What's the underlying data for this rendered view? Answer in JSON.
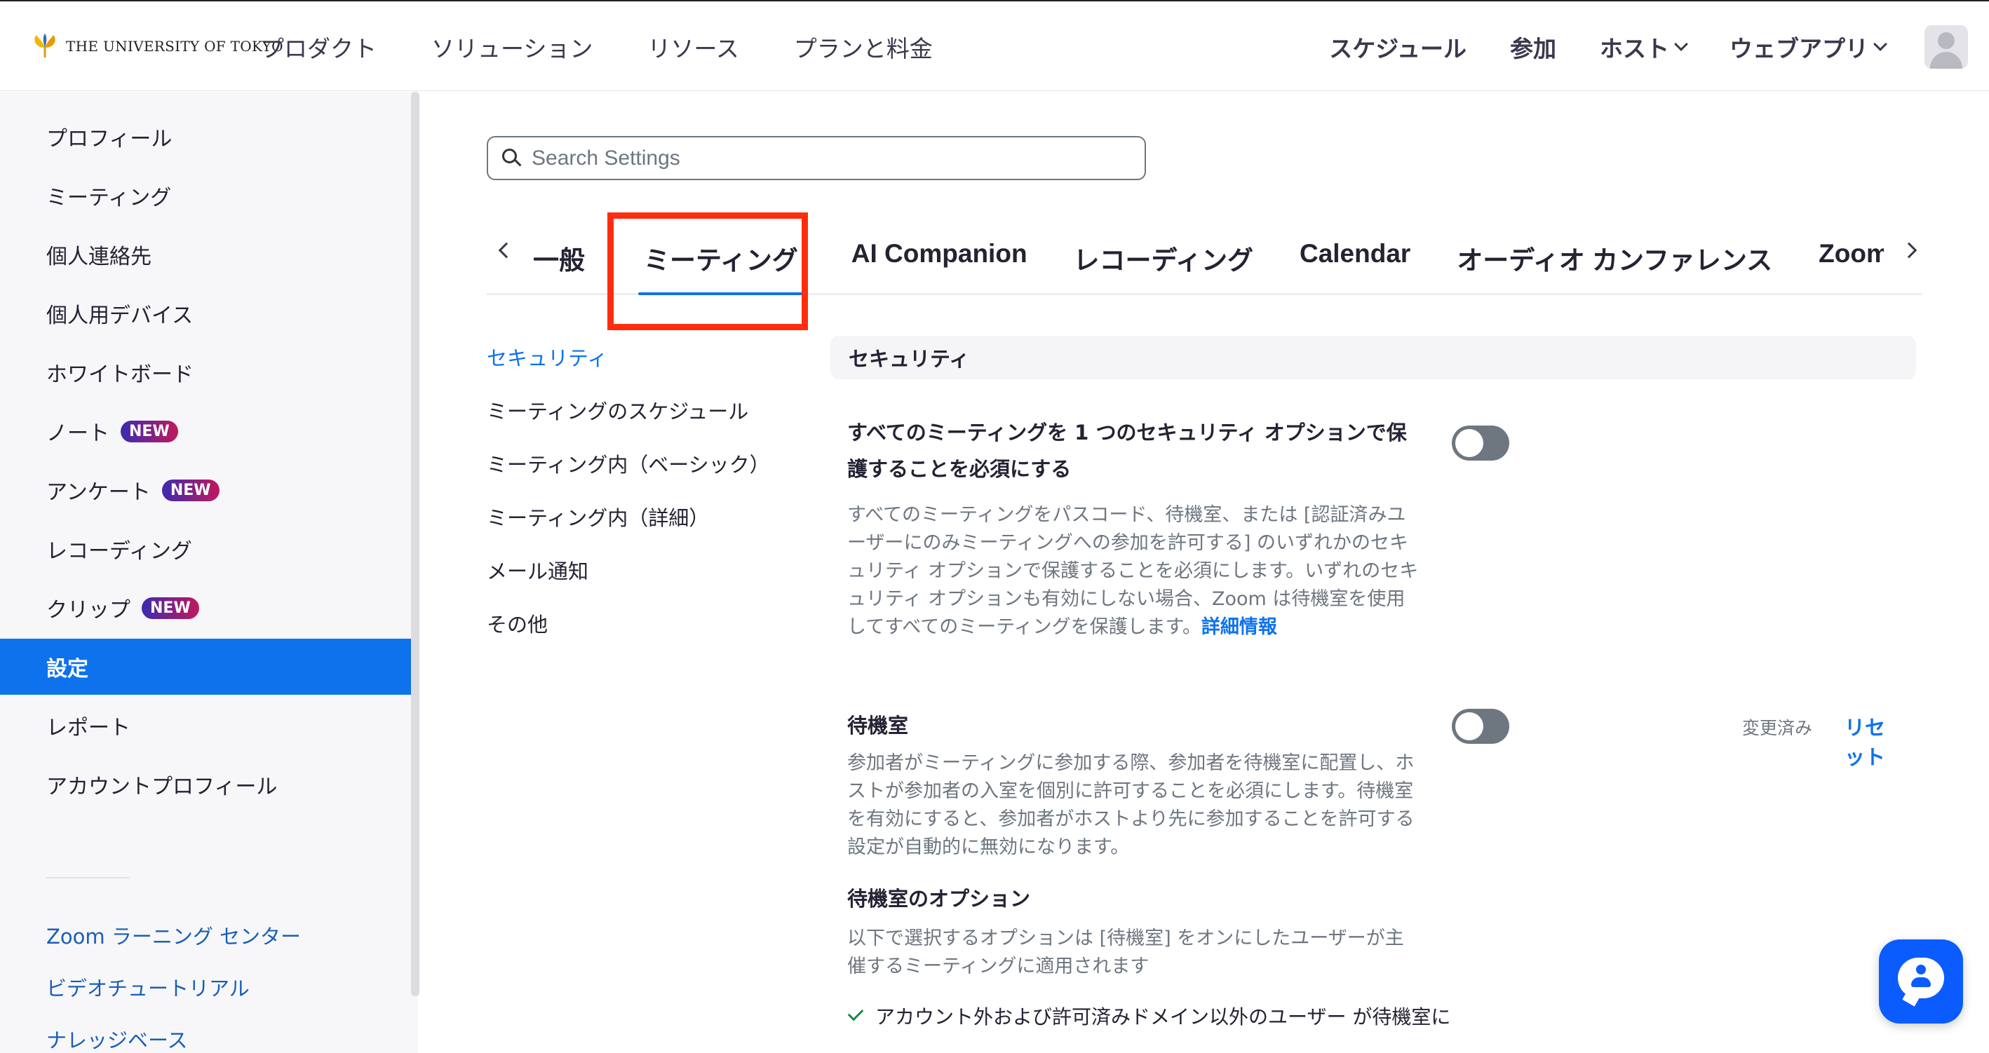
{
  "header": {
    "logo_text": "THE UNIVERSITY OF TOKYO",
    "nav_left": [
      "プロダクト",
      "ソリューション",
      "リソース",
      "プランと料金"
    ],
    "nav_right": {
      "schedule": "スケジュール",
      "join": "参加",
      "host": "ホスト",
      "web_app": "ウェブアプリ"
    }
  },
  "sidebar": {
    "items": [
      {
        "label": "プロフィール"
      },
      {
        "label": "ミーティング"
      },
      {
        "label": "個人連絡先"
      },
      {
        "label": "個人用デバイス"
      },
      {
        "label": "ホワイトボード"
      },
      {
        "label": "ノート",
        "badge": "NEW"
      },
      {
        "label": "アンケート",
        "badge": "NEW"
      },
      {
        "label": "レコーディング"
      },
      {
        "label": "クリップ",
        "badge": "NEW"
      },
      {
        "label": "設定"
      },
      {
        "label": "レポート"
      },
      {
        "label": "アカウントプロフィール"
      }
    ],
    "links": [
      "Zoom ラーニング センター",
      "ビデオチュートリアル",
      "ナレッジベース"
    ]
  },
  "search": {
    "placeholder": "Search Settings"
  },
  "tabs": [
    "一般",
    "ミーティング",
    "AI Companion",
    "レコーディング",
    "Calendar",
    "オーディオ カンファレンス",
    "Zoom Apps"
  ],
  "section_nav": [
    "セキュリティ",
    "ミーティングのスケジュール",
    "ミーティング内（ベーシック）",
    "ミーティング内（詳細）",
    "メール通知",
    "その他"
  ],
  "content": {
    "section_title": "セキュリティ",
    "setting1": {
      "title": "すべてのミーティングを 1 つのセキュリティ オプションで保護することを必須にする",
      "description": "すべてのミーティングをパスコード、待機室、または [認証済みユーザーにのみミーティングへの参加を許可する] のいずれかのセキュリティ オプションで保護することを必須にします。いずれのセキュリティ オプションも有効にしない場合、Zoom は待機室を使用してすべてのミーティングを保護します。",
      "link": "詳細情報"
    },
    "setting2": {
      "title": "待機室",
      "modified": "変更済み",
      "reset": "リセット",
      "description": "参加者がミーティングに参加する際、参加者を待機室に配置し、ホストが参加者の入室を個別に許可することを必須にします。待機室を有効にすると、参加者がホストより先に参加することを許可する設定が自動的に無効になります。",
      "options_title": "待機室のオプション",
      "options_description": "以下で選択するオプションは [待機室] をオンにしたユーザーが主催するミーティングに適用されます",
      "option1": "アカウント外および許可済みドメイン以外のユーザー が待機室に"
    }
  },
  "colors": {
    "accent": "#0e72ed",
    "highlight": "#ff2d0f"
  }
}
